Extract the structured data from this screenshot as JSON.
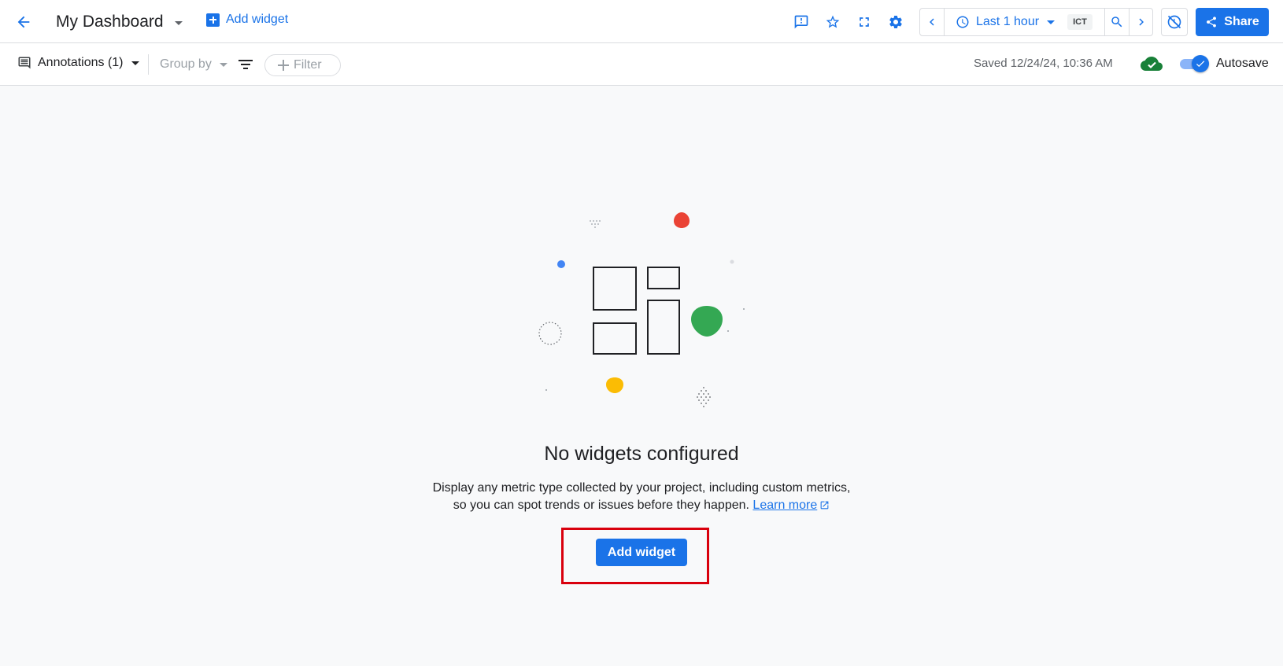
{
  "header": {
    "title": "My Dashboard",
    "add_widget_label": "Add widget",
    "time_range": "Last 1 hour",
    "timezone": "ICT",
    "share_label": "Share"
  },
  "toolbar": {
    "annotations_label": "Annotations (1)",
    "group_by_label": "Group by",
    "filter_label": "Filter",
    "saved_text": "Saved 12/24/24, 10:36 AM",
    "autosave_label": "Autosave",
    "autosave_on": true
  },
  "empty_state": {
    "title": "No widgets configured",
    "description_line1": "Display any metric type collected by your project, including custom metrics,",
    "description_line2": "so you can spot trends or issues before they happen.",
    "learn_more": "Learn more",
    "add_widget_label": "Add widget"
  },
  "colors": {
    "accent": "#1a73e8",
    "highlight": "#d9000d",
    "red": "#ea4335",
    "green": "#34a853",
    "yellow": "#fbbc04",
    "cloud_green": "#188038"
  },
  "icons": [
    "back-arrow-icon",
    "caret-down-icon",
    "add-box-icon",
    "feedback-icon",
    "star-icon",
    "fullscreen-icon",
    "gear-icon",
    "chevron-left-icon",
    "clock-icon",
    "zoom-icon",
    "chevron-right-icon",
    "link-off-icon",
    "share-icon",
    "annotations-icon",
    "filter-lines-icon",
    "plus-icon",
    "cloud-done-icon",
    "check-icon",
    "external-link-icon"
  ]
}
